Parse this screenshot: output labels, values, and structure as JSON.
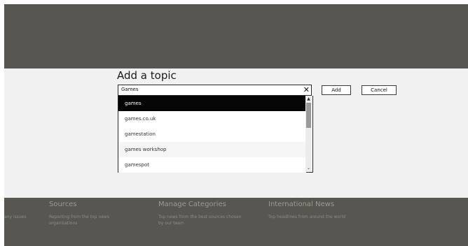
{
  "dialog": {
    "title": "Add a topic",
    "input_value": "Games",
    "clear_glyph": "✕",
    "add_label": "Add",
    "cancel_label": "Cancel",
    "suggestions": [
      "games",
      "games.co.uk",
      "gamestation",
      "games workshop",
      "gamespot"
    ],
    "selected_index": 0
  },
  "background": {
    "left_fragment": "any issues",
    "columns": [
      {
        "heading": "Sources",
        "description": "Reporting from the top news organisations"
      },
      {
        "heading": "Manage Categories",
        "description": "Top news from the best sources chosen by our team"
      },
      {
        "heading": "International News",
        "description": "Top headlines from around the world"
      }
    ]
  },
  "colors": {
    "backdrop": "#575651",
    "dialog_band": "#f1f1f1",
    "selected_row": "#050505"
  },
  "icons": {
    "clear": "close-icon",
    "scroll_up": "chevron-up-icon",
    "scroll_down": "chevron-down-icon"
  }
}
